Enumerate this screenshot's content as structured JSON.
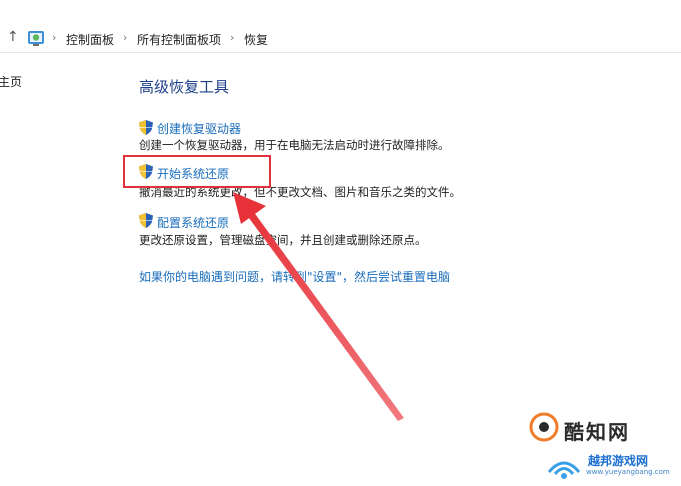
{
  "breadcrumb": {
    "items": [
      "控制面板",
      "所有控制面板项",
      "恢复"
    ],
    "separator": "›"
  },
  "leftnav": {
    "home_label": "主页"
  },
  "main": {
    "title": "高级恢复工具",
    "tasks": [
      {
        "link": "创建恢复驱动器",
        "desc": "创建一个恢复驱动器，用于在电脑无法启动时进行故障排除。"
      },
      {
        "link": "开始系统还原",
        "desc": "撤消最近的系统更改，但不更改文档、图片和音乐之类的文件。"
      },
      {
        "link": "配置系统还原",
        "desc": "更改还原设置，管理磁盘空间，并且创建或删除还原点。"
      }
    ],
    "reset_link": "如果你的电脑遇到问题，请转到\"设置\"，然后尝试重置电脑"
  },
  "watermark": {
    "brand1": "酷知网",
    "brand2": "越邦游戏网",
    "brand2_url": "www.yueyangbang.com"
  },
  "colors": {
    "link": "#1a6dbb",
    "title": "#1c3f8a",
    "annotation": "#e0313a",
    "shield_blue": "#2a62b8",
    "shield_yellow": "#f1c232"
  },
  "icons": [
    "up-arrow-icon",
    "control-panel-icon",
    "uac-shield-icon"
  ]
}
